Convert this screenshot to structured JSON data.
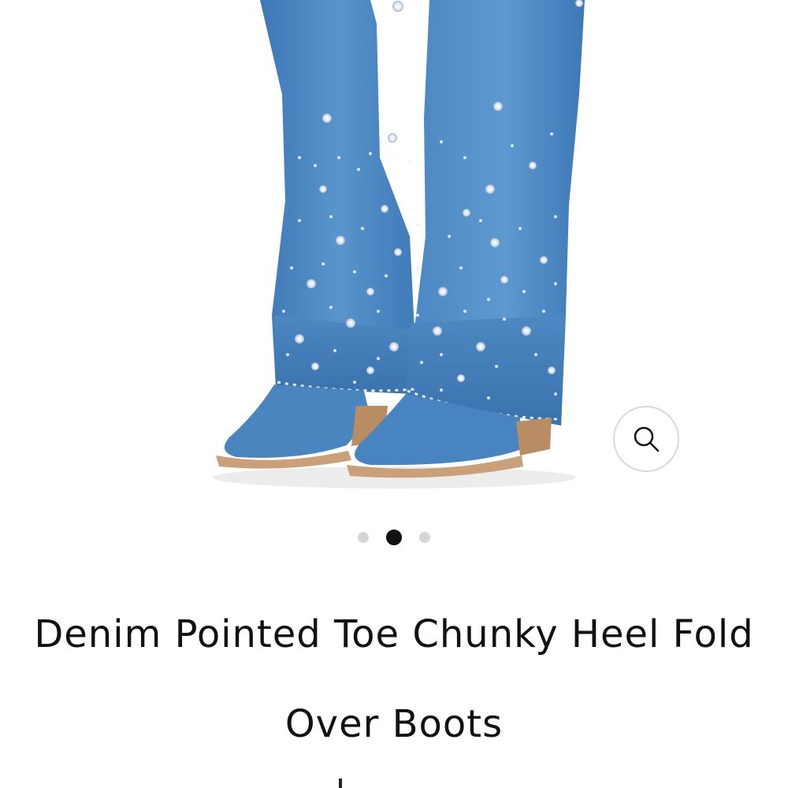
{
  "product": {
    "title": "Denim Pointed Toe Chunky Heel Fold Over Boots",
    "image_alt": "Denim rhinestone fold over boots"
  },
  "gallery": {
    "image_count": 3,
    "active_index": 1,
    "zoom_icon": "search-icon"
  },
  "colors": {
    "denim": "#4a86c2",
    "denim_dark": "#2f69a8",
    "heel": "#caa07a",
    "dot_inactive": "#d5d5d5",
    "dot_active": "#111111"
  }
}
